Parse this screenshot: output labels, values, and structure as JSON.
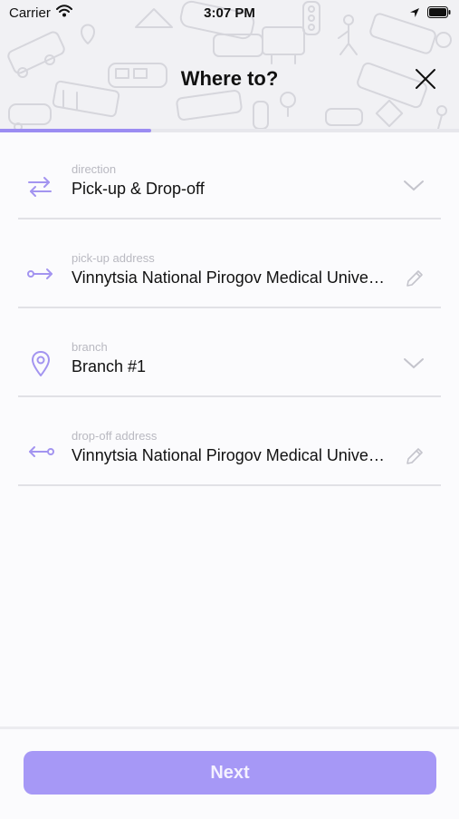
{
  "status_bar": {
    "carrier": "Carrier",
    "time": "3:07 PM"
  },
  "header": {
    "title": "Where to?",
    "progress_fraction": 0.33
  },
  "form": {
    "direction": {
      "label": "direction",
      "value": "Pick-up & Drop-off",
      "icon": "swap-arrows-icon"
    },
    "pickup": {
      "label": "pick-up address",
      "value": "Vinnytsia National Pirogov Medical University, Pyrohova St",
      "icon": "arrow-right-icon"
    },
    "branch": {
      "label": "branch",
      "value": "Branch #1",
      "icon": "location-pin-icon"
    },
    "dropoff": {
      "label": "drop-off address",
      "value": "Vinnytsia National Pirogov Medical University, Pyrohova St",
      "icon": "arrow-left-icon"
    }
  },
  "footer": {
    "next_label": "Next"
  },
  "colors": {
    "accent": "#9b8cf2",
    "button": "#a698f6",
    "icon": "#a394f0",
    "header_bg": "#f1f1f4"
  }
}
